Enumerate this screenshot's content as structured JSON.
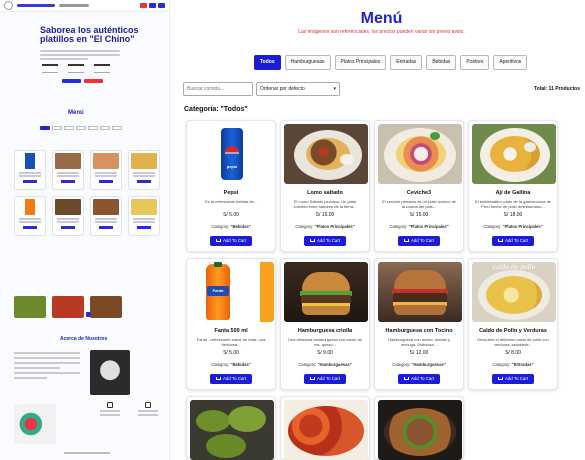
{
  "preview": {
    "hero_title": "Saborea los auténticos platillos en \"El Chino\"",
    "menu_title": "Menú",
    "about_title": "Acerca de Nosotros"
  },
  "menu": {
    "title": "Menú",
    "note": "Las imágenes son referenciales, los precios pueden variar sin previo aviso.",
    "tabs": [
      "Todos",
      "Hamburguesas",
      "Platos Principales",
      "Entradas",
      "Bebidas",
      "Postres",
      "Aperitivos"
    ],
    "active_tab": "Todos",
    "search_placeholder": "Buscar comida...",
    "sort_value": "Ordenar por defecto",
    "total_label": "Total: 11 Productos",
    "category_heading": "Categoría: \"Todos\""
  },
  "products": [
    {
      "name": "Pepsi",
      "desc": "Es la refrescante bebida de...",
      "price": "S/ 5.00",
      "category_label": "Category:",
      "category": "\"Bebidas\"",
      "button": "Add To Cart",
      "thumb": "pepsi"
    },
    {
      "name": "Lomo saltado",
      "desc": "El Lomo Saltado peruano: Un plato colorido entre sabores de la tierra...",
      "price": "S/ 15.00",
      "category_label": "Category:",
      "category": "\"Platos Principales\"",
      "button": "Add To Cart",
      "thumb": "lomo"
    },
    {
      "name": "Ceviche3",
      "desc": "El ceviche peruano es un plato icónico de la cocina del país...",
      "price": "S/ 15.00",
      "category_label": "Category:",
      "category": "\"Platos Principales\"",
      "button": "Add To Cart",
      "thumb": "ceviche"
    },
    {
      "name": "Ají de Gallina",
      "desc": "El emblemático plato de la gastronomía de Perú hecho de pollo deshilachado...",
      "price": "S/ 18.00",
      "category_label": "Category:",
      "category": "\"Platos Principales\"",
      "button": "Add To Cart",
      "thumb": "aji"
    },
    {
      "name": "Fanta 500 ml",
      "desc": "Fanta - refrescante sabor de fruta, una deliciosa...",
      "price": "S/ 5.00",
      "category_label": "Category:",
      "category": "\"Bebidas\"",
      "button": "Add To Cart",
      "thumb": "fanta"
    },
    {
      "name": "Hamburguesa criolla",
      "desc": "Una deliciosa hamburguesa con carne de res, queso...",
      "price": "S/ 9.00",
      "category_label": "Category:",
      "category": "\"Hamburguesas\"",
      "button": "Add To Cart",
      "thumb": "burger"
    },
    {
      "name": "Hamburguesa con Tocino",
      "desc": "Hamburguesa con tocino, tomate y lechuga. Deliciosa...",
      "price": "S/ 12.00",
      "category_label": "Category:",
      "category": "\"Hamburguesas\"",
      "button": "Add To Cart",
      "thumb": "bacon"
    },
    {
      "name": "Caldo de Pollo y Verduras",
      "desc": "Descubre el delicioso caldo de pollo con verduras, saludable...",
      "price": "S/ 8.00",
      "category_label": "Category:",
      "category": "\"Entradas\"",
      "button": "Add To Cart",
      "thumb": "caldo",
      "overlay": "caldo de pollo"
    },
    {
      "thumb": "tequenos"
    },
    {
      "thumb": "alitas"
    },
    {
      "thumb": "salteado"
    }
  ],
  "colors": {
    "accent": "#1c1cd6",
    "note": "#e23030",
    "title": "#2222cc"
  }
}
